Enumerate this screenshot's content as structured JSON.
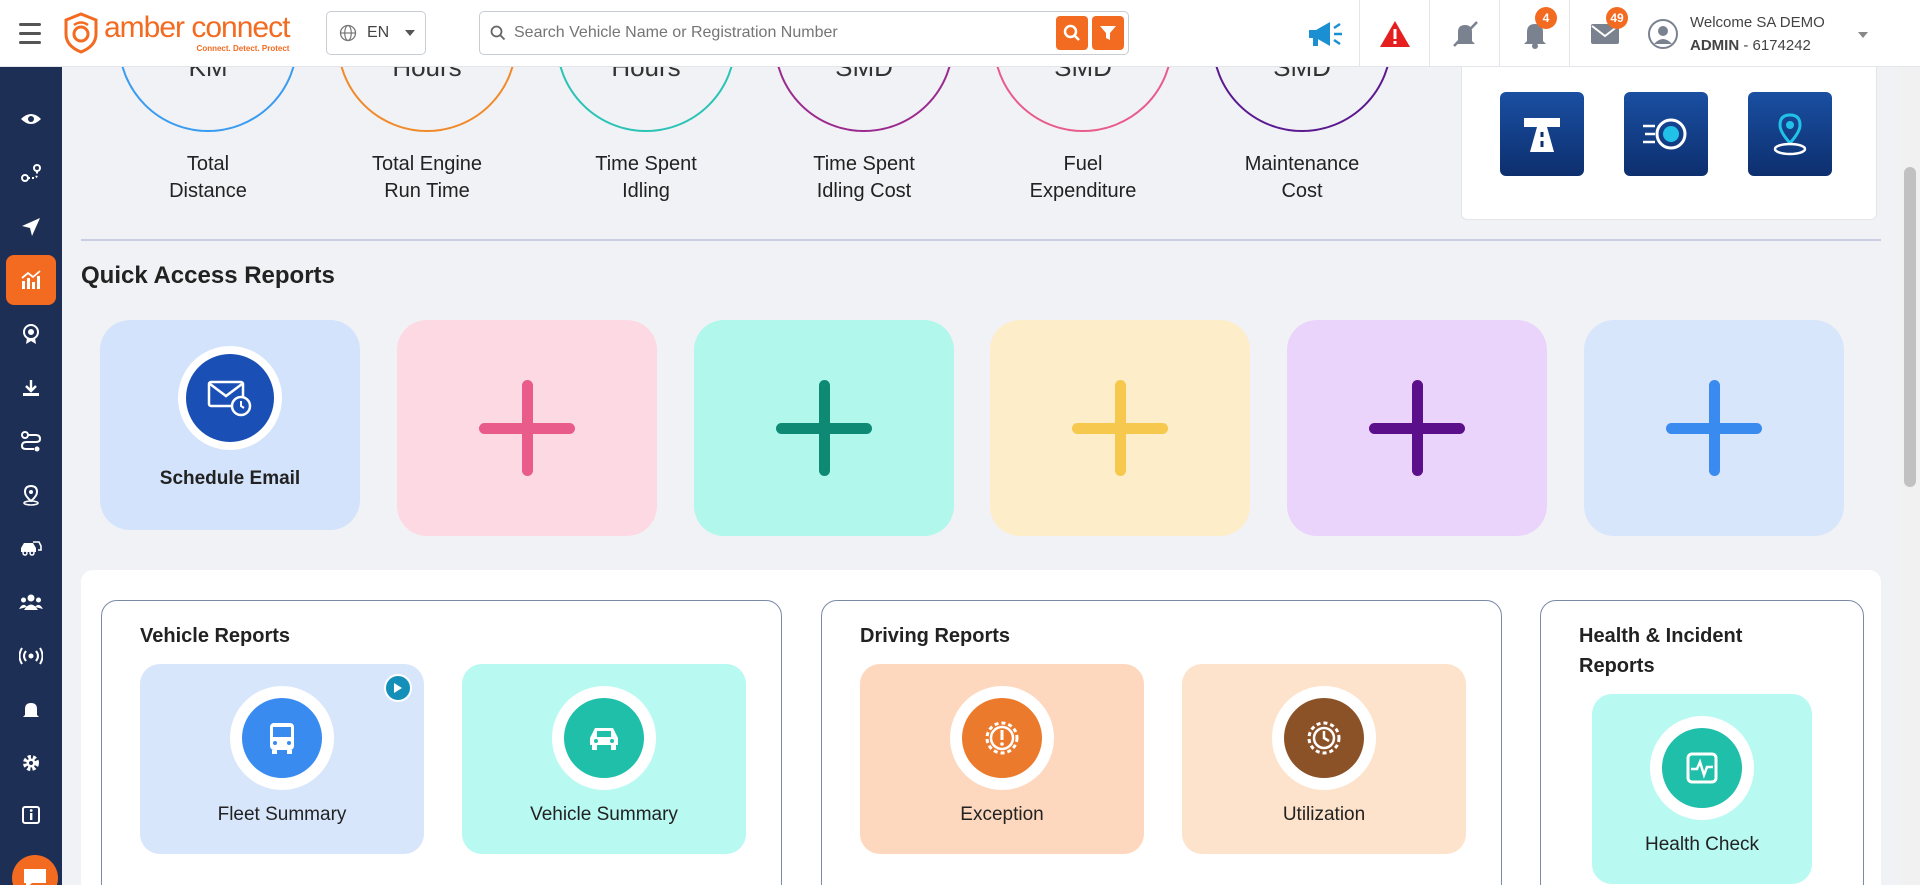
{
  "header": {
    "logo_title": "amber connect",
    "logo_tagline": "Connect. Detect. Protect",
    "language": "EN",
    "search_placeholder": "Search Vehicle Name or Registration Number",
    "notifications_count": "4",
    "messages_count": "49",
    "welcome_text": "Welcome SA DEMO",
    "user_role": "ADMIN",
    "user_id": " - 6174242"
  },
  "summary": [
    {
      "value": "KM",
      "label_line1": "Total",
      "label_line2": "Distance",
      "color": "#3a9bf0"
    },
    {
      "value": "Hours",
      "label_line1": "Total Engine",
      "label_line2": "Run Time",
      "color": "#f08a2a"
    },
    {
      "value": "Hours",
      "label_line1": "Time Spent",
      "label_line2": "Idling",
      "color": "#2ac3b5"
    },
    {
      "value": "SMD",
      "label_line1": "Time Spent",
      "label_line2": "Idling Cost",
      "color": "#9b2a8f"
    },
    {
      "value": "SMD",
      "label_line1": "Fuel",
      "label_line2": "Expenditure",
      "color": "#e85b8a"
    },
    {
      "value": "SMD",
      "label_line1": "Maintenance",
      "label_line2": "Cost",
      "color": "#5b1a8f"
    }
  ],
  "quick_access": {
    "title": "Quick Access Reports",
    "cards": [
      {
        "label": "Schedule Email",
        "bg": "#d3e3fb"
      },
      {
        "bg": "#fdd9e4",
        "plus_color": "#e85b8a"
      },
      {
        "bg": "#b2f7ec",
        "plus_color": "#0e8a74"
      },
      {
        "bg": "#fdedc8",
        "plus_color": "#f7c84e"
      },
      {
        "bg": "#ead4fb",
        "plus_color": "#5b0f8a"
      },
      {
        "bg": "#d8e6fb",
        "plus_color": "#3a8bf0"
      }
    ]
  },
  "report_groups": {
    "vehicle": {
      "title": "Vehicle Reports",
      "items": [
        {
          "label": "Fleet Summary",
          "icon": "bus-icon"
        },
        {
          "label": "Vehicle Summary",
          "icon": "car-icon"
        }
      ]
    },
    "driving": {
      "title": "Driving Reports",
      "items": [
        {
          "label": "Exception",
          "icon": "alert-gear-icon"
        },
        {
          "label": "Utilization",
          "icon": "clock-gear-icon"
        }
      ]
    },
    "health": {
      "title_line1": "Health & Incident",
      "title_line2": "Reports",
      "items": [
        {
          "label": "Health Check",
          "icon": "heartbeat-icon"
        }
      ]
    }
  }
}
